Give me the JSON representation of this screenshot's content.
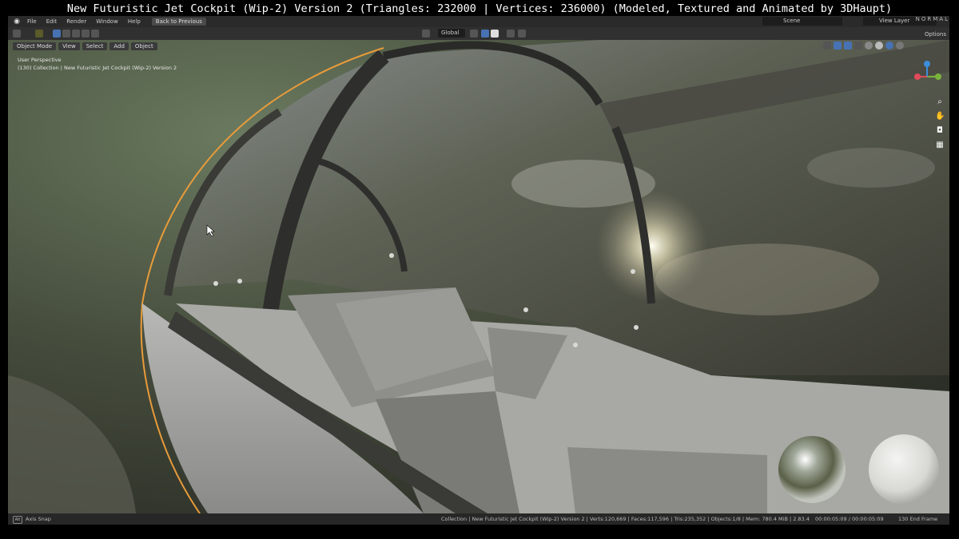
{
  "caption": "New Futuristic Jet Cockpit (Wip-2) Version 2 (Triangles: 232000 | Vertices: 236000)  (Modeled, Textured and Animated by 3DHaupt)",
  "topbar": {
    "menus": [
      "File",
      "Edit",
      "Render",
      "Window",
      "Help"
    ],
    "back_button": "Back to Previous",
    "scene": "Scene",
    "view_layer": "View Layer",
    "normal_label": "NORMAL"
  },
  "toolbar": {
    "orientation": "Global",
    "options": "Options"
  },
  "viewport_header": {
    "mode": "Object Mode",
    "menus": [
      "View",
      "Select",
      "Add",
      "Object"
    ]
  },
  "overlay": {
    "view_name": "User Perspective",
    "collection": "(130) Collection | New Futuristic Jet Cockpit (Wip-2) Version 2"
  },
  "gizmo": {
    "x": "X",
    "y": "Y",
    "z": "Z"
  },
  "statusbar": {
    "alt_key": "Alt",
    "axis_snap": "Axis Snap",
    "info": "Collection | New Futuristic Jet Cockpit (Wip-2) Version 2 | Verts:120,669 | Faces:117,596 | Tris:235,352 | Objects:1/8 | Mem: 780.4 MiB | 2.83.4",
    "time": "00:00:05:09 / 00:00:05:09",
    "end_frame": "130 End Frame"
  },
  "colors": {
    "selection_outline": "#e89b3a",
    "ui_dark": "#2a2a2a",
    "gizmo_x": "#e04a5a",
    "gizmo_y": "#7ab33c",
    "gizmo_z": "#3c8ed9"
  }
}
